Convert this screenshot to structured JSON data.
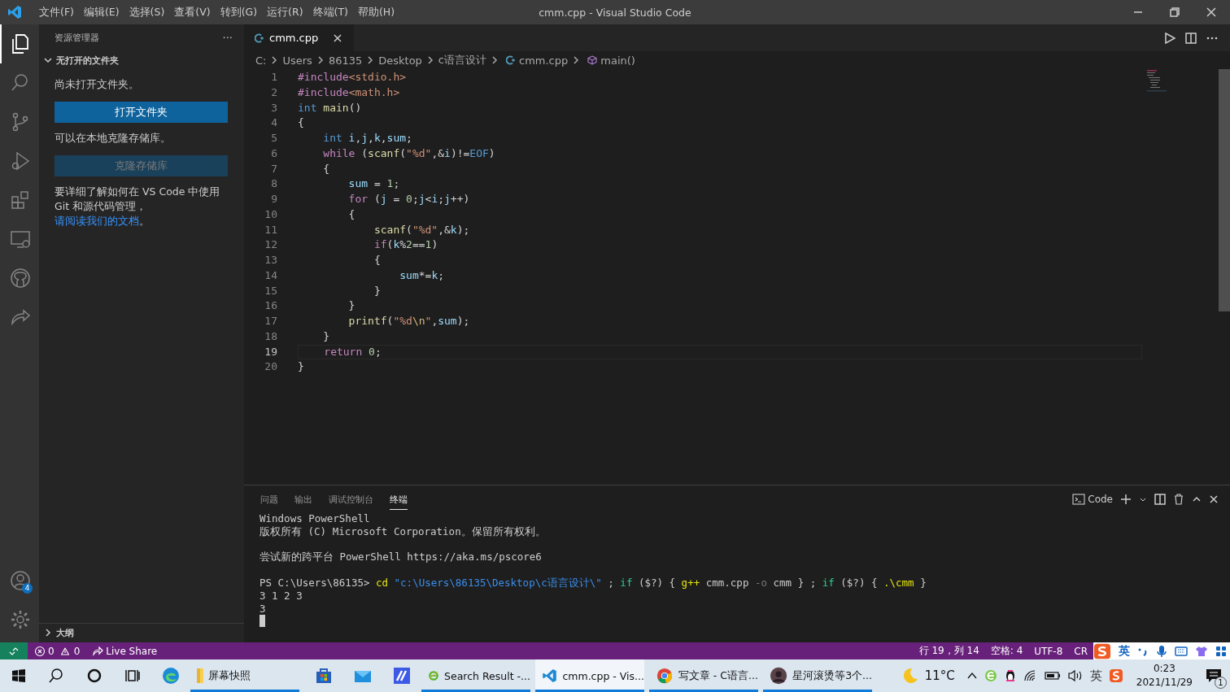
{
  "window": {
    "title": "cmm.cpp - Visual Studio Code"
  },
  "menu": [
    "文件(F)",
    "编辑(E)",
    "选择(S)",
    "查看(V)",
    "转到(G)",
    "运行(R)",
    "终端(T)",
    "帮助(H)"
  ],
  "activity_bar": {
    "items": [
      {
        "kind": "files",
        "selected": true
      },
      {
        "kind": "search",
        "selected": false
      },
      {
        "kind": "branch",
        "selected": false
      },
      {
        "kind": "debug",
        "selected": false
      },
      {
        "kind": "blocks",
        "selected": false
      },
      {
        "kind": "monitor",
        "selected": false
      },
      {
        "kind": "github",
        "selected": false
      },
      {
        "kind": "share",
        "selected": false
      }
    ],
    "accounts_badge": "4"
  },
  "sidebar": {
    "title": "资源管理器",
    "more": "···",
    "section": {
      "title": "无打开的文件夹",
      "expanded": true
    },
    "no_folder_text": "尚未打开文件夹。",
    "buttons": [
      {
        "label": "打开文件夹",
        "disabled": false
      }
    ],
    "clone_text": "可以在本地克隆存储库。",
    "clone_button": {
      "label": "克隆存储库",
      "disabled": true
    },
    "help_text": "要详细了解如何在 VS Code 中使用 Git 和源代码管理，",
    "help_link": "请阅读我们的文档",
    "help_end": "。",
    "outline": {
      "title": "大纲",
      "expanded": false
    }
  },
  "tabs": [
    {
      "label": "cmm.cpp",
      "selected": true,
      "close": "×"
    }
  ],
  "breadcrumb": [
    {
      "label": "C:",
      "kind": "folder"
    },
    {
      "label": "Users",
      "kind": "folder"
    },
    {
      "label": "86135",
      "kind": "folder"
    },
    {
      "label": "Desktop",
      "kind": "folder"
    },
    {
      "label": "c语言设计",
      "kind": "folder"
    },
    {
      "label": "cmm.cpp",
      "kind": "file"
    },
    {
      "label": "main()",
      "kind": "symbol"
    }
  ],
  "code": [
    {
      "n": "1",
      "current": false,
      "tokens": [
        {
          "kind": "pp",
          "text": "#include"
        },
        {
          "kind": "inc",
          "text": "<stdio.h>"
        }
      ]
    },
    {
      "n": "2",
      "current": false,
      "tokens": [
        {
          "kind": "pp",
          "text": "#include"
        },
        {
          "kind": "inc",
          "text": "<math.h>"
        }
      ]
    },
    {
      "n": "3",
      "current": false,
      "tokens": [
        {
          "kind": "kw",
          "text": "int"
        },
        {
          "kind": "fn",
          "text": " main"
        },
        {
          "kind": "p",
          "text": "()"
        }
      ]
    },
    {
      "n": "4",
      "current": false,
      "tokens": [
        {
          "kind": "p",
          "text": "{"
        }
      ]
    },
    {
      "n": "5",
      "current": false,
      "tokens": [
        {
          "kind": "kw",
          "text": "    int"
        },
        {
          "kind": "var",
          "text": " i"
        },
        {
          "kind": "p",
          "text": ","
        },
        {
          "kind": "var",
          "text": "j"
        },
        {
          "kind": "p",
          "text": ","
        },
        {
          "kind": "var",
          "text": "k"
        },
        {
          "kind": "p",
          "text": ","
        },
        {
          "kind": "var",
          "text": "sum"
        },
        {
          "kind": "p",
          "text": ";"
        }
      ]
    },
    {
      "n": "6",
      "current": false,
      "tokens": [
        {
          "kind": "ctl",
          "text": "    while"
        },
        {
          "kind": "p",
          "text": " ("
        },
        {
          "kind": "fn",
          "text": "scanf"
        },
        {
          "kind": "p",
          "text": "("
        },
        {
          "kind": "str",
          "text": "\"%d\""
        },
        {
          "kind": "p",
          "text": ",&"
        },
        {
          "kind": "var",
          "text": "i"
        },
        {
          "kind": "p",
          "text": ")!="
        },
        {
          "kind": "kw",
          "text": "EOF"
        },
        {
          "kind": "p",
          "text": ")"
        }
      ]
    },
    {
      "n": "7",
      "current": false,
      "tokens": [
        {
          "kind": "p",
          "text": "    {"
        }
      ]
    },
    {
      "n": "8",
      "current": false,
      "tokens": [
        {
          "kind": "var",
          "text": "        sum"
        },
        {
          "kind": "p",
          "text": " = "
        },
        {
          "kind": "num",
          "text": "1"
        },
        {
          "kind": "p",
          "text": ";"
        }
      ]
    },
    {
      "n": "9",
      "current": false,
      "tokens": [
        {
          "kind": "ctl",
          "text": "        for"
        },
        {
          "kind": "p",
          "text": " ("
        },
        {
          "kind": "var",
          "text": "j"
        },
        {
          "kind": "p",
          "text": " = "
        },
        {
          "kind": "num",
          "text": "0"
        },
        {
          "kind": "p",
          "text": ";"
        },
        {
          "kind": "var",
          "text": "j"
        },
        {
          "kind": "p",
          "text": "<"
        },
        {
          "kind": "var",
          "text": "i"
        },
        {
          "kind": "p",
          "text": ";"
        },
        {
          "kind": "var",
          "text": "j"
        },
        {
          "kind": "p",
          "text": "++)"
        }
      ]
    },
    {
      "n": "10",
      "current": false,
      "tokens": [
        {
          "kind": "p",
          "text": "        {"
        }
      ]
    },
    {
      "n": "11",
      "current": false,
      "tokens": [
        {
          "kind": "fn",
          "text": "            scanf"
        },
        {
          "kind": "p",
          "text": "("
        },
        {
          "kind": "str",
          "text": "\"%d\""
        },
        {
          "kind": "p",
          "text": ",&"
        },
        {
          "kind": "var",
          "text": "k"
        },
        {
          "kind": "p",
          "text": ");"
        }
      ]
    },
    {
      "n": "12",
      "current": false,
      "tokens": [
        {
          "kind": "ctl",
          "text": "            if"
        },
        {
          "kind": "p",
          "text": "("
        },
        {
          "kind": "var",
          "text": "k"
        },
        {
          "kind": "p",
          "text": "%"
        },
        {
          "kind": "num",
          "text": "2"
        },
        {
          "kind": "p",
          "text": "=="
        },
        {
          "kind": "num",
          "text": "1"
        },
        {
          "kind": "p",
          "text": ")"
        }
      ]
    },
    {
      "n": "13",
      "current": false,
      "tokens": [
        {
          "kind": "p",
          "text": "            {"
        }
      ]
    },
    {
      "n": "14",
      "current": false,
      "tokens": [
        {
          "kind": "var",
          "text": "                sum"
        },
        {
          "kind": "p",
          "text": "*="
        },
        {
          "kind": "var",
          "text": "k"
        },
        {
          "kind": "p",
          "text": ";"
        }
      ]
    },
    {
      "n": "15",
      "current": false,
      "tokens": [
        {
          "kind": "p",
          "text": "            }"
        }
      ]
    },
    {
      "n": "16",
      "current": false,
      "tokens": [
        {
          "kind": "p",
          "text": "        }"
        }
      ]
    },
    {
      "n": "17",
      "current": false,
      "tokens": [
        {
          "kind": "fn",
          "text": "        printf"
        },
        {
          "kind": "p",
          "text": "("
        },
        {
          "kind": "str",
          "text": "\"%d"
        },
        {
          "kind": "esc",
          "text": "\\n"
        },
        {
          "kind": "str",
          "text": "\""
        },
        {
          "kind": "p",
          "text": ","
        },
        {
          "kind": "var",
          "text": "sum"
        },
        {
          "kind": "p",
          "text": ");"
        }
      ]
    },
    {
      "n": "18",
      "current": false,
      "tokens": [
        {
          "kind": "p",
          "text": "    }"
        }
      ]
    },
    {
      "n": "19",
      "current": true,
      "tokens": [
        {
          "kind": "ctl",
          "text": "    return"
        },
        {
          "kind": "num",
          "text": " 0"
        },
        {
          "kind": "p",
          "text": ";"
        }
      ]
    },
    {
      "n": "20",
      "current": false,
      "tokens": [
        {
          "kind": "p",
          "text": "}"
        }
      ]
    }
  ],
  "panel": {
    "tabs": [
      {
        "label": "问题",
        "selected": false
      },
      {
        "label": "输出",
        "selected": false
      },
      {
        "label": "调试控制台",
        "selected": false
      },
      {
        "label": "终端",
        "selected": true
      }
    ],
    "terminal_name": "Code",
    "terminal": [
      {
        "kind": "line",
        "tokens": [
          {
            "kind": "p",
            "text": "Windows PowerShell"
          }
        ]
      },
      {
        "kind": "line",
        "tokens": [
          {
            "kind": "p",
            "text": "版权所有 (C) Microsoft Corporation。保留所有权利。"
          }
        ]
      },
      {
        "kind": "blank"
      },
      {
        "kind": "line",
        "tokens": [
          {
            "kind": "p",
            "text": "尝试新的跨平台 PowerShell https://aka.ms/pscore6"
          }
        ]
      },
      {
        "kind": "blank"
      },
      {
        "kind": "line",
        "tokens": [
          {
            "kind": "p",
            "text": "PS C:\\Users\\86135>"
          },
          {
            "kind": "cmd",
            "text": " cd"
          },
          {
            "kind": "str",
            "text": " \"c:\\Users\\86135\\Desktop\\c语言设计\\\""
          },
          {
            "kind": "p",
            "text": " ;"
          },
          {
            "kind": "kw",
            "text": " if"
          },
          {
            "kind": "p",
            "text": " ($?) {"
          },
          {
            "kind": "cmd",
            "text": " g++"
          },
          {
            "kind": "p",
            "text": " cmm.cpp"
          },
          {
            "kind": "dim",
            "text": " -o"
          },
          {
            "kind": "p",
            "text": " cmm } ;"
          },
          {
            "kind": "kw",
            "text": " if"
          },
          {
            "kind": "p",
            "text": " ($?) {"
          },
          {
            "kind": "cmd",
            "text": " .\\cmm"
          },
          {
            "kind": "p",
            "text": " }"
          }
        ]
      },
      {
        "kind": "line",
        "tokens": [
          {
            "kind": "p",
            "text": "3 1 2 3"
          }
        ]
      },
      {
        "kind": "line",
        "tokens": [
          {
            "kind": "p",
            "text": "3"
          }
        ]
      }
    ]
  },
  "status_bar": {
    "errors": "0",
    "warnings": "0",
    "live_share": "Live Share",
    "right": [
      "行 19，列 14",
      "空格: 4",
      "UTF-8",
      "CR"
    ]
  },
  "ime_bar": {
    "mode": "英"
  },
  "taskbar": {
    "apps": [
      {
        "kind": "edge",
        "open": false,
        "selected": false
      },
      {
        "kind": "folder",
        "label": "屏幕快照",
        "open": true,
        "selected": false
      },
      {
        "kind": "store",
        "open": false,
        "selected": false
      },
      {
        "kind": "mail",
        "open": false,
        "selected": false
      },
      {
        "kind": "app",
        "open": false,
        "selected": false
      },
      {
        "kind": "ie",
        "label": "Search Result -...",
        "open": true,
        "selected": false
      },
      {
        "kind": "vscode",
        "label": "cmm.cpp - Vis...",
        "open": true,
        "selected": true
      },
      {
        "kind": "chrome",
        "label": "写文章 - C语言...",
        "open": true,
        "selected": false
      },
      {
        "kind": "avatar",
        "label": "星河滚烫等3个...",
        "open": true,
        "selected": false
      }
    ],
    "weather": "11°C",
    "ime": "英",
    "time": "0:23",
    "date": "2021/11/29",
    "notifications": "1"
  }
}
